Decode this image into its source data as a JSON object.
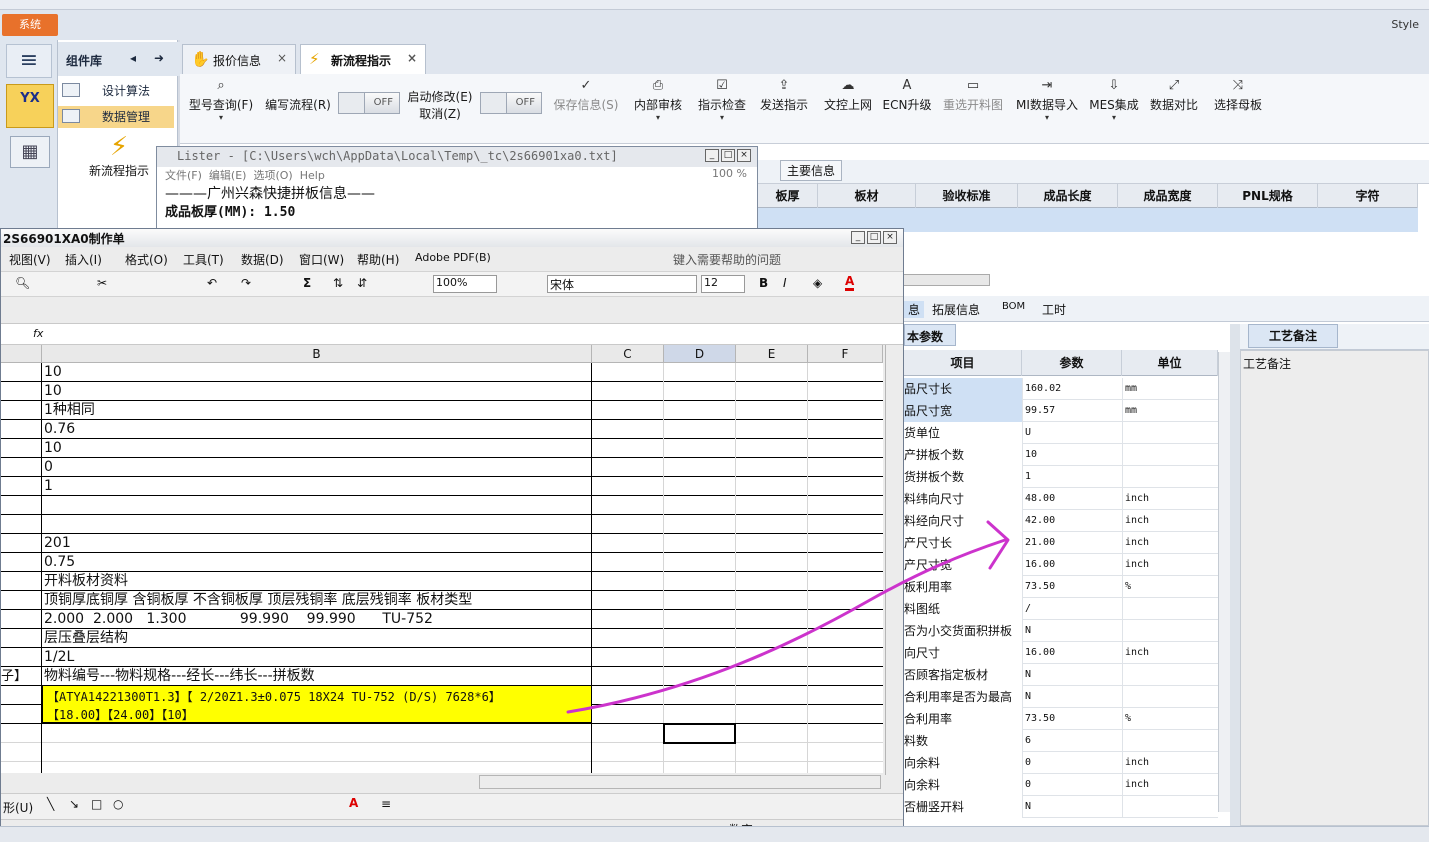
{
  "app": {
    "system_button": "系统",
    "style_label": "Style"
  },
  "sidebar": {
    "app_icon_label": "YX"
  },
  "component_panel": {
    "title": "组件库",
    "items": [
      {
        "label": "设计算法"
      },
      {
        "label": "数据管理"
      }
    ],
    "new_flow_label": "新流程指示"
  },
  "tabs": [
    {
      "label": "报价信息"
    },
    {
      "label": "新流程指示"
    }
  ],
  "toolbar": {
    "items": [
      {
        "label": "型号查询(F)"
      },
      {
        "label": "编写流程(R)"
      },
      {
        "label": "启动修改(E)"
      },
      {
        "label": "取消(Z)"
      },
      {
        "label": "保存信息(S)"
      },
      {
        "label": "内部审核"
      },
      {
        "label": "指示检查"
      },
      {
        "label": "发送指示"
      },
      {
        "label": "文控上网"
      },
      {
        "label": "ECN升级"
      },
      {
        "label": "重选开料图"
      },
      {
        "label": "MI数据导入"
      },
      {
        "label": "MES集成"
      },
      {
        "label": "数据对比"
      },
      {
        "label": "选择母板"
      }
    ],
    "toggle_off": "OFF"
  },
  "lister": {
    "title": "Lister - [C:\\Users\\wch\\AppData\\Local\\Temp\\_tc\\2s66901xa0.txt]",
    "menu": [
      "文件(F)",
      "编辑(E)",
      "选项(O)",
      "Help"
    ],
    "zoom": "100 %",
    "line1": "———广州兴森快捷拼板信息——",
    "line2": "成品板厚(MM): 1.50"
  },
  "main_info": {
    "section_label": "主要信息",
    "columns": [
      "板厚",
      "板材",
      "验收标准",
      "成品长度",
      "成品宽度",
      "PNL规格",
      "字符"
    ]
  },
  "bottom_tabs": [
    "息",
    "拓展信息",
    "BOM",
    "工时"
  ],
  "basic_params": {
    "label": "本参数",
    "columns": [
      "项目",
      "参数",
      "单位"
    ],
    "rows": [
      {
        "item": "品尺寸长",
        "value": "160.02",
        "unit": "mm"
      },
      {
        "item": "品尺寸宽",
        "value": "99.57",
        "unit": "mm"
      },
      {
        "item": "货单位",
        "value": "U",
        "unit": ""
      },
      {
        "item": "产拼板个数",
        "value": "10",
        "unit": ""
      },
      {
        "item": "货拼板个数",
        "value": "1",
        "unit": ""
      },
      {
        "item": "料纬向尺寸",
        "value": "48.00",
        "unit": "inch"
      },
      {
        "item": "料经向尺寸",
        "value": "42.00",
        "unit": "inch"
      },
      {
        "item": "产尺寸长",
        "value": "21.00",
        "unit": "inch"
      },
      {
        "item": "产尺寸宽",
        "value": "16.00",
        "unit": "inch"
      },
      {
        "item": "板利用率",
        "value": "73.50",
        "unit": "%"
      },
      {
        "item": "料图纸",
        "value": "/",
        "unit": ""
      },
      {
        "item": "否为小交货面积拼板",
        "value": "N",
        "unit": ""
      },
      {
        "item": "向尺寸",
        "value": "16.00",
        "unit": "inch"
      },
      {
        "item": "否顾客指定板材",
        "value": "N",
        "unit": ""
      },
      {
        "item": "合利用率是否为最高",
        "value": "N",
        "unit": ""
      },
      {
        "item": "合利用率",
        "value": "73.50",
        "unit": "%"
      },
      {
        "item": "料数",
        "value": "6",
        "unit": ""
      },
      {
        "item": "向余料",
        "value": "0",
        "unit": "inch"
      },
      {
        "item": "向余料",
        "value": "0",
        "unit": "inch"
      },
      {
        "item": "否栅竖开料",
        "value": "N",
        "unit": ""
      }
    ]
  },
  "craft": {
    "tab": "工艺备注",
    "label": "工艺备注"
  },
  "excel": {
    "title": "2S66901XA0制作单",
    "menu": [
      "视图(V)",
      "插入(I)",
      "格式(O)",
      "工具(T)",
      "数据(D)",
      "窗口(W)",
      "帮助(H)",
      "Adobe PDF(B)"
    ],
    "help_placeholder": "键入需要帮助的问题",
    "zoom": "100%",
    "font": "宋体",
    "font_size": "12",
    "fx": "fx",
    "columns": [
      "B",
      "C",
      "D",
      "E",
      "F"
    ],
    "rows": [
      {
        "a": "",
        "b": "10"
      },
      {
        "a": "",
        "b": "10"
      },
      {
        "a": "",
        "b": "1种相同"
      },
      {
        "a": "",
        "b": "0.76"
      },
      {
        "a": "",
        "b": "10"
      },
      {
        "a": "",
        "b": "0"
      },
      {
        "a": "",
        "b": "1"
      },
      {
        "a": "",
        "b": ""
      },
      {
        "a": "",
        "b": ""
      },
      {
        "a": "",
        "b": "201"
      },
      {
        "a": "",
        "b": "0.75"
      },
      {
        "a": "",
        "b": "开料板材资料"
      },
      {
        "a": "",
        "b": "顶铜厚底铜厚 含铜板厚 不含铜板厚 顶层残铜率 底层残铜率 板材类型"
      },
      {
        "a": "",
        "b": "2.000  2.000   1.300            99.990    99.990      TU-752"
      },
      {
        "a": "",
        "b": "层压叠层结构"
      },
      {
        "a": "",
        "b": "1/2L"
      },
      {
        "a": "子】",
        "b": "物料编号---物料规格---经长---纬长---拼板数"
      }
    ],
    "highlight_line1": "【ATYA14221300T1.3】【 2/20Z1.3±0.075 18X24  TU-752 (D/S) 7628*6】",
    "highlight_line2": "【18.00】【24.00】【10】",
    "status": "数字",
    "draw_label": "形(U)"
  }
}
